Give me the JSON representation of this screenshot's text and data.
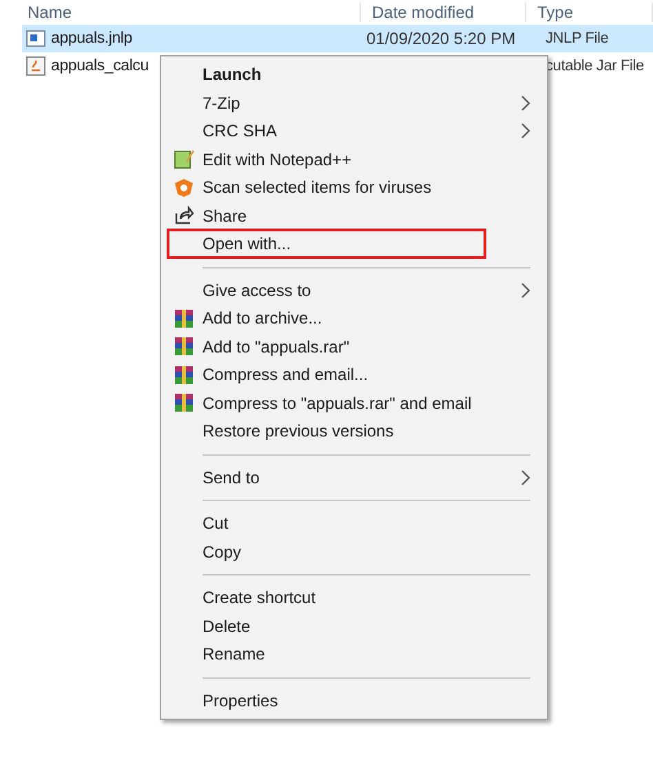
{
  "columns": [
    "Name",
    "Date modified",
    "Type"
  ],
  "files": [
    {
      "name": "appuals.jnlp",
      "date": "01/09/2020 5:20 PM",
      "type": "JNLP File",
      "selected": true
    },
    {
      "name": "appuals_calcu",
      "type": "cutable Jar File",
      "selected": false
    }
  ],
  "menu": {
    "groups": [
      {
        "items": [
          {
            "kind": "plain",
            "label": "Launch",
            "bold": true
          },
          {
            "kind": "plain",
            "label": "7-Zip",
            "submenu": true
          },
          {
            "kind": "plain",
            "label": "CRC SHA",
            "submenu": true
          },
          {
            "kind": "notepad",
            "label": "Edit with Notepad++"
          },
          {
            "kind": "scan",
            "label": "Scan selected items for viruses"
          },
          {
            "kind": "share",
            "label": "Share"
          },
          {
            "kind": "plain",
            "label": "Open with...",
            "outlined": true
          }
        ]
      },
      {
        "items": [
          {
            "kind": "plain",
            "label": "Give access to",
            "submenu": true
          },
          {
            "kind": "archive",
            "label": "Add to archive..."
          },
          {
            "kind": "archive",
            "label": "Add to \"appuals.rar\""
          },
          {
            "kind": "archive",
            "label": "Compress and email..."
          },
          {
            "kind": "archive",
            "label": "Compress to \"appuals.rar\" and email"
          },
          {
            "kind": "plain",
            "label": "Restore previous versions"
          }
        ]
      },
      {
        "items": [
          {
            "kind": "plain",
            "label": "Send to",
            "submenu": true
          }
        ]
      },
      {
        "items": [
          {
            "kind": "plain",
            "label": "Cut"
          },
          {
            "kind": "plain",
            "label": "Copy"
          }
        ]
      },
      {
        "items": [
          {
            "kind": "plain",
            "label": "Create shortcut"
          },
          {
            "kind": "plain",
            "label": "Delete"
          },
          {
            "kind": "plain",
            "label": "Rename"
          }
        ]
      },
      {
        "items": [
          {
            "kind": "plain",
            "label": "Properties"
          }
        ]
      }
    ]
  }
}
